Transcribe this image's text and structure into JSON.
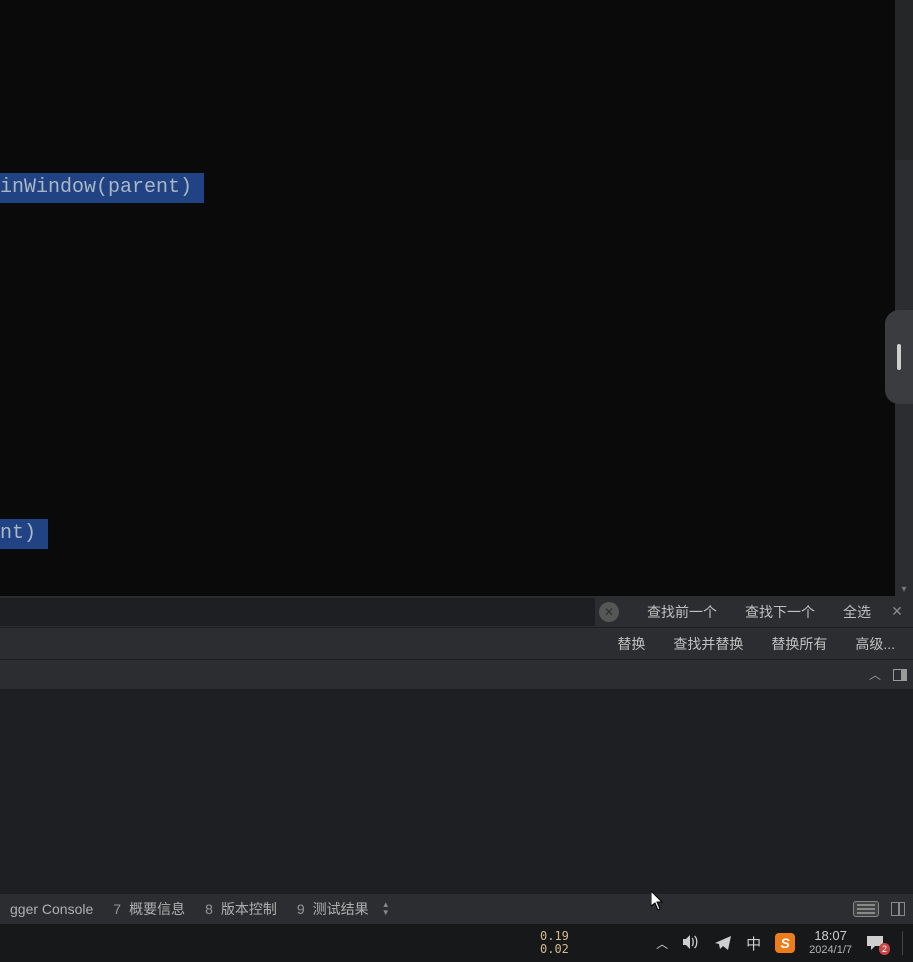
{
  "editor": {
    "line1_fn": "inWindow",
    "line1_rest": "(parent)",
    "line2": "nt)"
  },
  "find": {
    "clear_glyph": "✕",
    "find_prev": "查找前一个",
    "find_next": "查找下一个",
    "select_all": "全选",
    "close_glyph": "✕",
    "replace": "替换",
    "find_replace": "查找并替换",
    "replace_all": "替换所有",
    "advanced": "高级..."
  },
  "panel_header": {
    "collapse_glyph": "︿"
  },
  "toolbar": {
    "console_partial": "gger Console",
    "tabs": [
      {
        "num": "7",
        "label": "概要信息"
      },
      {
        "num": "8",
        "label": "版本控制"
      },
      {
        "num": "9",
        "label": "测试结果"
      }
    ]
  },
  "taskbar": {
    "metric_top": "0.19",
    "metric_bottom": "0.02",
    "ime": "中",
    "sogou": "S",
    "time": "18:07",
    "date": "2024/1/7",
    "notif_badge": "2"
  }
}
